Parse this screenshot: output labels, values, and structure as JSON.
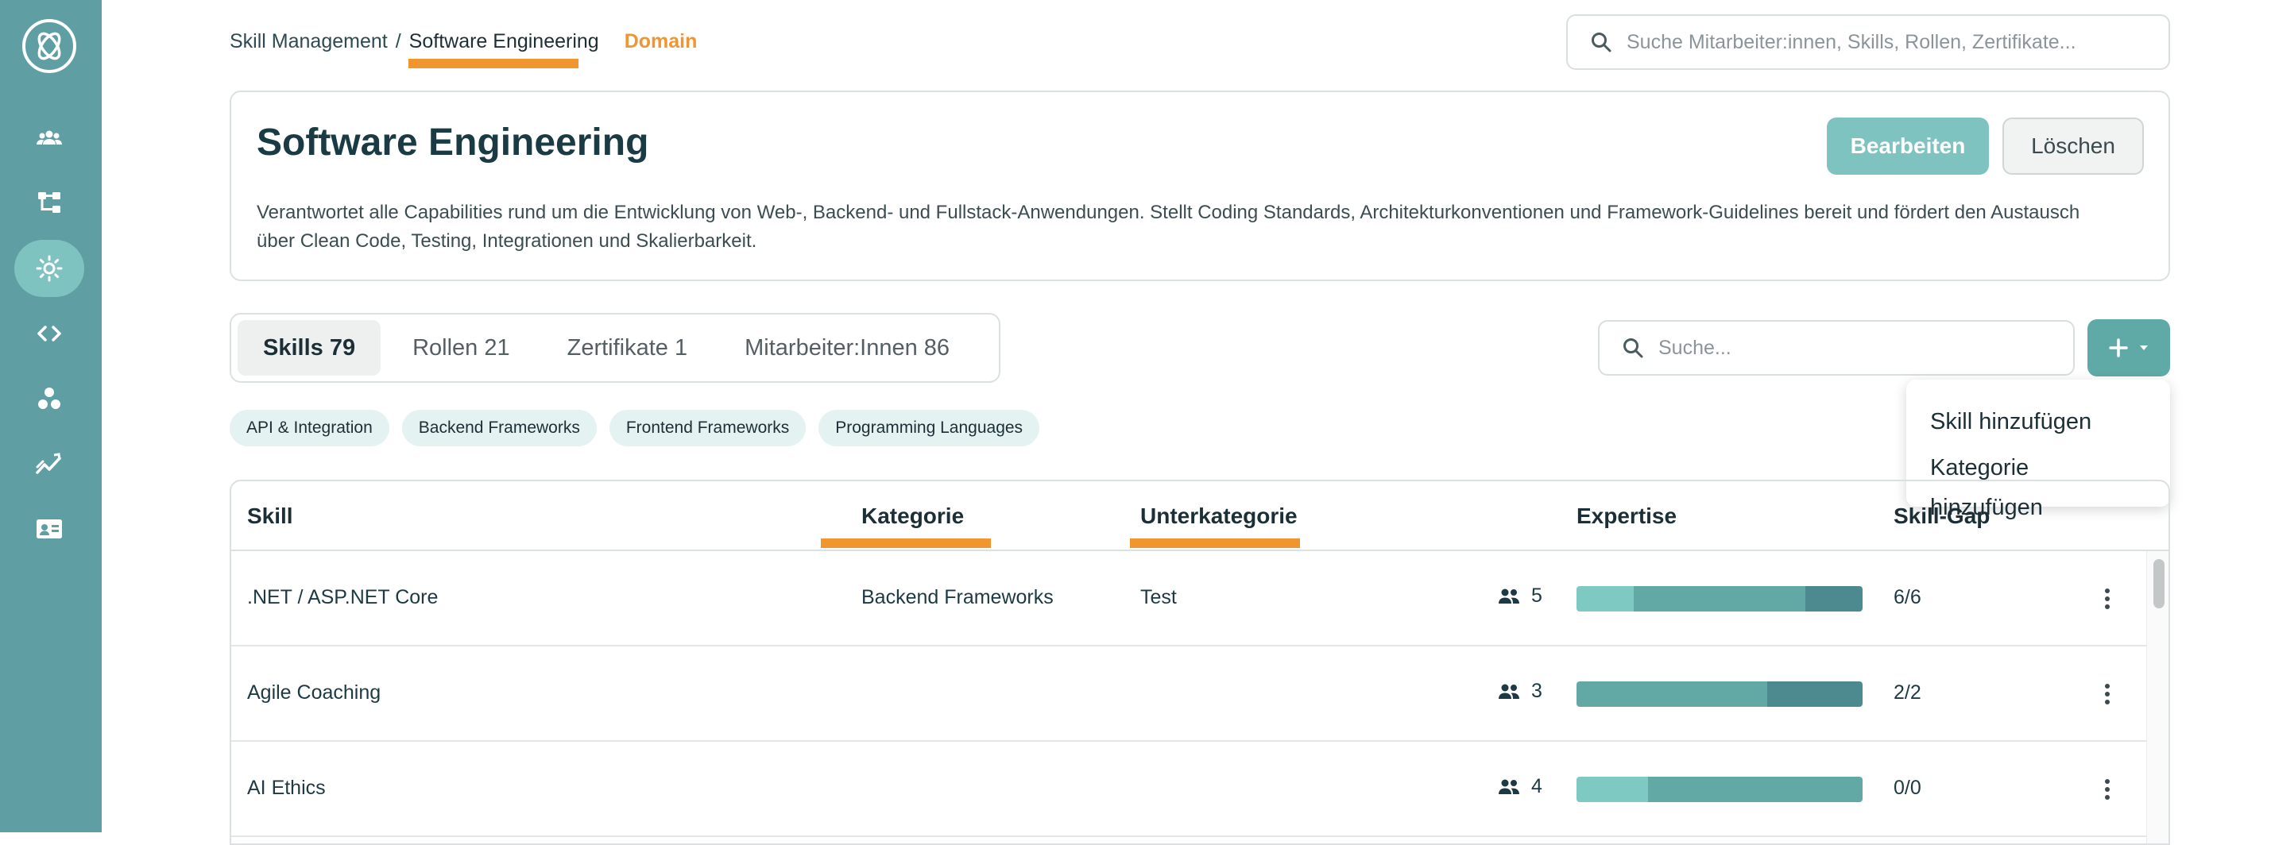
{
  "sidebar": {
    "items": [
      {
        "icon": "people-icon",
        "active": false
      },
      {
        "icon": "hierarchy-icon",
        "active": false
      },
      {
        "icon": "sun-icon",
        "active": true
      },
      {
        "icon": "code-icon",
        "active": false
      },
      {
        "icon": "circles-icon",
        "active": false
      },
      {
        "icon": "trend-icon",
        "active": false
      },
      {
        "icon": "contact-card-icon",
        "active": false
      }
    ]
  },
  "breadcrumb": {
    "root": "Skill Management",
    "separator": "/",
    "current": "Software Engineering",
    "type": "Domain"
  },
  "top_search": {
    "placeholder": "Suche Mitarbeiter:innen, Skills, Rollen, Zertifikate..."
  },
  "domain": {
    "title": "Software Engineering",
    "description": "Verantwortet alle Capabilities rund um die Entwicklung von Web-, Backend- und Fullstack-Anwendungen. Stellt Coding Standards, Architekturkonventionen und Framework-Guidelines bereit und fördert den Austausch über Clean Code, Testing, Integrationen und Skalierbarkeit.",
    "edit_label": "Bearbeiten",
    "delete_label": "Löschen"
  },
  "tabs": [
    {
      "label": "Skills 79",
      "active": true
    },
    {
      "label": "Rollen 21",
      "active": false
    },
    {
      "label": "Zertifikate 1",
      "active": false
    },
    {
      "label": "Mitarbeiter:Innen 86",
      "active": false
    }
  ],
  "list_search": {
    "placeholder": "Suche..."
  },
  "add_menu": {
    "items": [
      "Skill hinzufügen",
      "Kategorie hinzufügen"
    ]
  },
  "chips": [
    "API & Integration",
    "Backend Frameworks",
    "Frontend Frameworks",
    "Programming Languages"
  ],
  "table": {
    "headers": {
      "skill": "Skill",
      "kategorie": "Kategorie",
      "unterkategorie": "Unterkategorie",
      "expertise": "Expertise",
      "skill_gap": "Skill-Gap"
    },
    "rows": [
      {
        "skill": ".NET / ASP.NET Core",
        "kategorie": "Backend Frameworks",
        "unterkategorie": "Test",
        "count": "5",
        "expertise": [
          0.2,
          0.6,
          0.2
        ],
        "gap": "6/6"
      },
      {
        "skill": "Agile Coaching",
        "kategorie": "",
        "unterkategorie": "",
        "count": "3",
        "expertise": [
          0.0,
          0.667,
          0.333
        ],
        "gap": "2/2"
      },
      {
        "skill": "AI Ethics",
        "kategorie": "",
        "unterkategorie": "",
        "count": "4",
        "expertise": [
          0.25,
          0.75,
          0.0
        ],
        "gap": "0/0"
      }
    ]
  },
  "colors": {
    "sidebar": "#5f9ea3",
    "accent_orange": "#f0952f",
    "primary_teal": "#7ec3c0",
    "expertise_levels": [
      "#7fc9c3",
      "#62a8a5",
      "#4d8a8f"
    ]
  }
}
